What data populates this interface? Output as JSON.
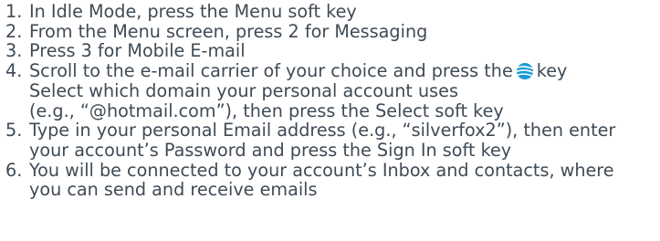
{
  "steps": [
    {
      "number": "1.",
      "lines": [
        "In Idle Mode, press the Menu soft key"
      ]
    },
    {
      "number": "2.",
      "lines": [
        "From the Menu screen, press 2 for Messaging"
      ]
    },
    {
      "number": "3.",
      "lines": [
        "Press 3 for Mobile E-mail"
      ]
    },
    {
      "number": "4.",
      "line1_before_icon": "Scroll to the e-mail carrier of your choice and press the",
      "line1_after_icon": "key",
      "icon": "att-globe-key-icon",
      "lines": [
        "Select which domain your personal account uses",
        "(e.g., “@hotmail.com”), then press the Select soft key"
      ]
    },
    {
      "number": "5.",
      "lines": [
        "Type in your personal Email address (e.g., “silverfox2”), then enter",
        "your account’s Password and press the Sign In soft key"
      ]
    },
    {
      "number": "6.",
      "lines": [
        "You will be connected to your account’s Inbox and contacts, where",
        "you can send and receive emails"
      ]
    }
  ],
  "colors": {
    "text": "#3f4a55",
    "icon_blue": "#1a9ad6"
  }
}
